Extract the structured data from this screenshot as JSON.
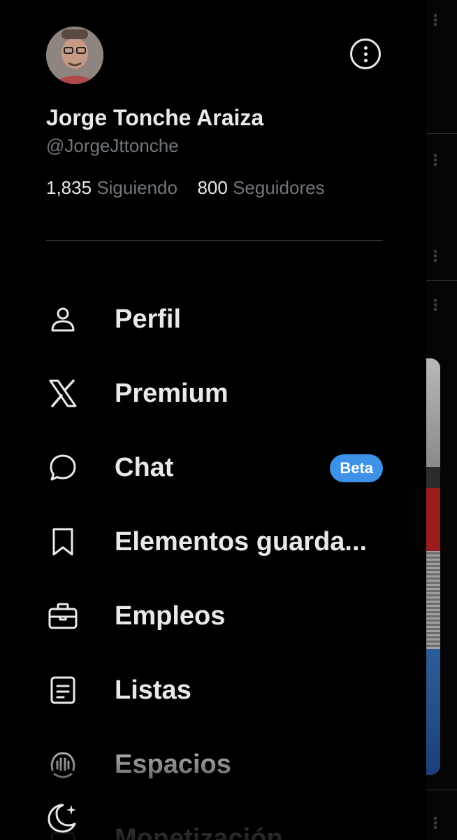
{
  "profile": {
    "name": "Jorge Tonche Araiza",
    "handle": "@JorgeJttonche",
    "following_count": "1,835",
    "following_label": "Siguiendo",
    "followers_count": "800",
    "followers_label": "Seguidores"
  },
  "menu": {
    "items": [
      {
        "label": "Perfil",
        "icon": "person-icon"
      },
      {
        "label": "Premium",
        "icon": "x-logo-icon"
      },
      {
        "label": "Chat",
        "icon": "chat-bubble-icon",
        "badge": "Beta"
      },
      {
        "label": "Elementos guarda...",
        "icon": "bookmark-icon"
      },
      {
        "label": "Empleos",
        "icon": "briefcase-icon"
      },
      {
        "label": "Listas",
        "icon": "list-document-icon"
      },
      {
        "label": "Espacios",
        "icon": "spaces-microphone-icon"
      },
      {
        "label": "Monetización",
        "icon": "monetization-icon"
      }
    ]
  },
  "colors": {
    "background": "#000000",
    "text_primary": "#e7e9ea",
    "text_secondary": "#71767b",
    "beta_badge": "#3d92e8",
    "divider": "#2f3336"
  }
}
